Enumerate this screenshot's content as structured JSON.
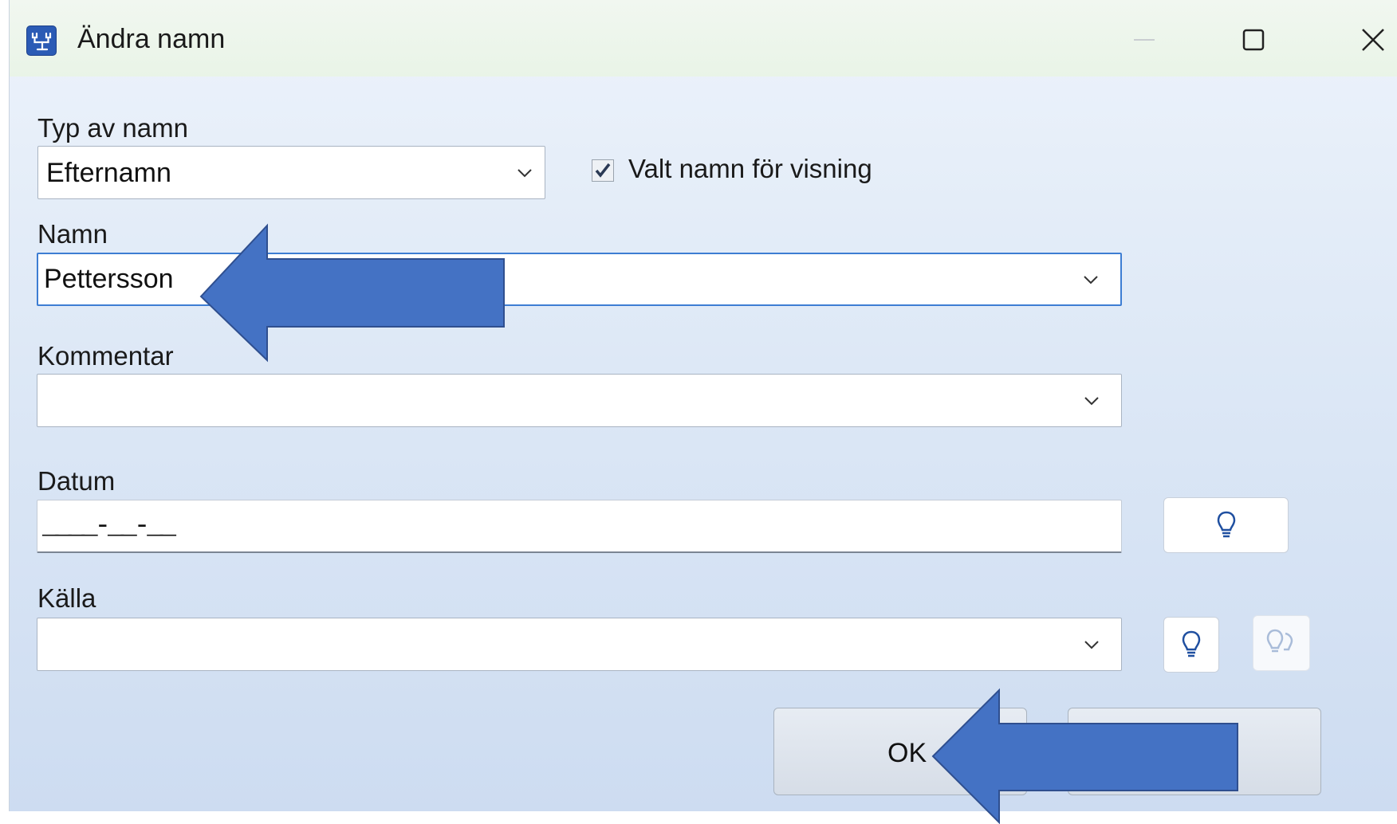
{
  "window": {
    "title": "Ändra namn",
    "icon": "family-tree-app-icon",
    "controls": [
      "minimize-icon",
      "maximize-icon",
      "close-icon"
    ]
  },
  "form": {
    "name_type": {
      "label": "Typ av namn",
      "value": "Efternamn"
    },
    "display_checkbox": {
      "label": "Valt namn för visning",
      "checked": true
    },
    "name": {
      "label": "Namn",
      "value": "Pettersson"
    },
    "comment": {
      "label": "Kommentar",
      "value": ""
    },
    "date": {
      "label": "Datum",
      "mask": "____-__-__"
    },
    "source": {
      "label": "Källa",
      "value": ""
    }
  },
  "buttons": {
    "ok": "OK",
    "cancel": ""
  },
  "colors": {
    "annotation_arrow": "#4472C4",
    "annotation_arrow_border": "#2F4F8F",
    "focus_border": "#3d7dd3"
  }
}
